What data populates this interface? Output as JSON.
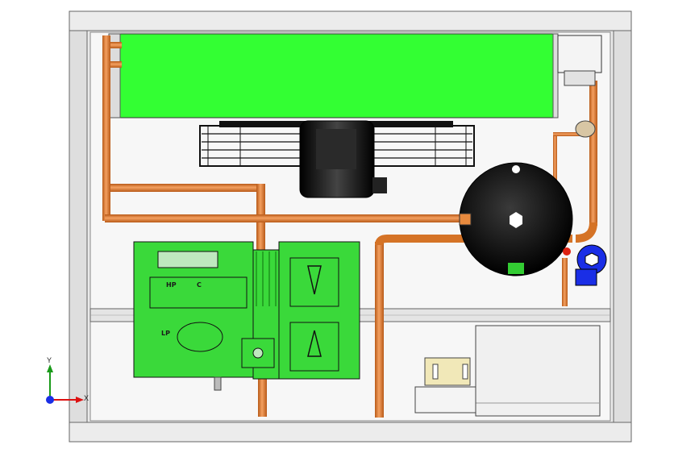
{
  "labels": {
    "lp": "LP",
    "hp": "HP",
    "c": "C"
  },
  "axes": {
    "x": "X",
    "y": "Y"
  },
  "colors": {
    "frame": "#e6e6e6",
    "panel": "#f2f2f2",
    "coil": "#33ff33",
    "copper": "#e07a2e",
    "compressor": "#3ad93a",
    "fan": "#111111",
    "valve_blue": "#1a2ee6",
    "axis_x": "#d11",
    "axis_y": "#1a9a1a",
    "axis_z": "#1a2ee6"
  }
}
